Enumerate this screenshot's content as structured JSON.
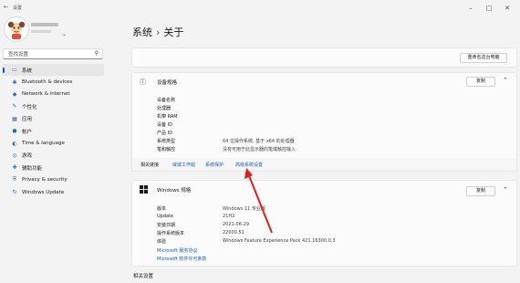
{
  "window": {
    "title": "设置",
    "minimize": "–",
    "maximize": "□",
    "close": "✕"
  },
  "search": {
    "placeholder": "查找设置"
  },
  "sidebar": {
    "items": [
      {
        "label": "系统",
        "icon": "system-icon",
        "glyph": "▭"
      },
      {
        "label": "Bluetooth & devices",
        "icon": "bluetooth-icon",
        "glyph": "✱"
      },
      {
        "label": "Network & internet",
        "icon": "network-icon",
        "glyph": "◆"
      },
      {
        "label": "个性化",
        "icon": "brush-icon",
        "glyph": "✎"
      },
      {
        "label": "应用",
        "icon": "apps-icon",
        "glyph": "▦"
      },
      {
        "label": "帐户",
        "icon": "account-icon",
        "glyph": "●"
      },
      {
        "label": "Time & language",
        "icon": "globe-icon",
        "glyph": "◐"
      },
      {
        "label": "游戏",
        "icon": "gaming-icon",
        "glyph": "◎"
      },
      {
        "label": "辅助功能",
        "icon": "accessibility-icon",
        "glyph": "✚"
      },
      {
        "label": "Privacy & security",
        "icon": "shield-icon",
        "glyph": "⛨"
      },
      {
        "label": "Windows Update",
        "icon": "update-icon",
        "glyph": "↻"
      }
    ]
  },
  "breadcrumb": {
    "parent": "系统",
    "separator": "›",
    "current": "关于"
  },
  "rename_button": "重命名这台电脑",
  "device_spec": {
    "title": "设备规格",
    "copy": "复制",
    "rows": [
      {
        "label": "设备名称",
        "value": ""
      },
      {
        "label": "处理器",
        "value": ""
      },
      {
        "label": "机带 RAM",
        "value": ""
      },
      {
        "label": "设备 ID",
        "value": ""
      },
      {
        "label": "产品 ID",
        "value": ""
      },
      {
        "label": "系统类型",
        "value": "64 位操作系统, 基于 x64 的处理器"
      },
      {
        "label": "笔和触控",
        "value": "没有可用于此显示器的笔或触控输入"
      }
    ]
  },
  "related_links": {
    "label": "相关链接",
    "links": [
      "域或工作组",
      "系统保护",
      "高级系统设置"
    ]
  },
  "windows_spec": {
    "title": "Windows 规格",
    "copy": "复制",
    "rows": [
      {
        "label": "版本",
        "value": "Windows 11 专业版"
      },
      {
        "label": "Update",
        "value": "21H2"
      },
      {
        "label": "安装日期",
        "value": "2021-06-29"
      },
      {
        "label": "操作系统版本",
        "value": "22000.51"
      },
      {
        "label": "体验",
        "value": "Windows Feature Experience Pack 421.16300.0.3"
      }
    ],
    "links": [
      "Microsoft 服务协议",
      "Microsoft 软件许可条款"
    ]
  },
  "related_settings": "相关设置",
  "colors": {
    "accent": "#005fb8",
    "annotation_arrow": "#e02020"
  }
}
